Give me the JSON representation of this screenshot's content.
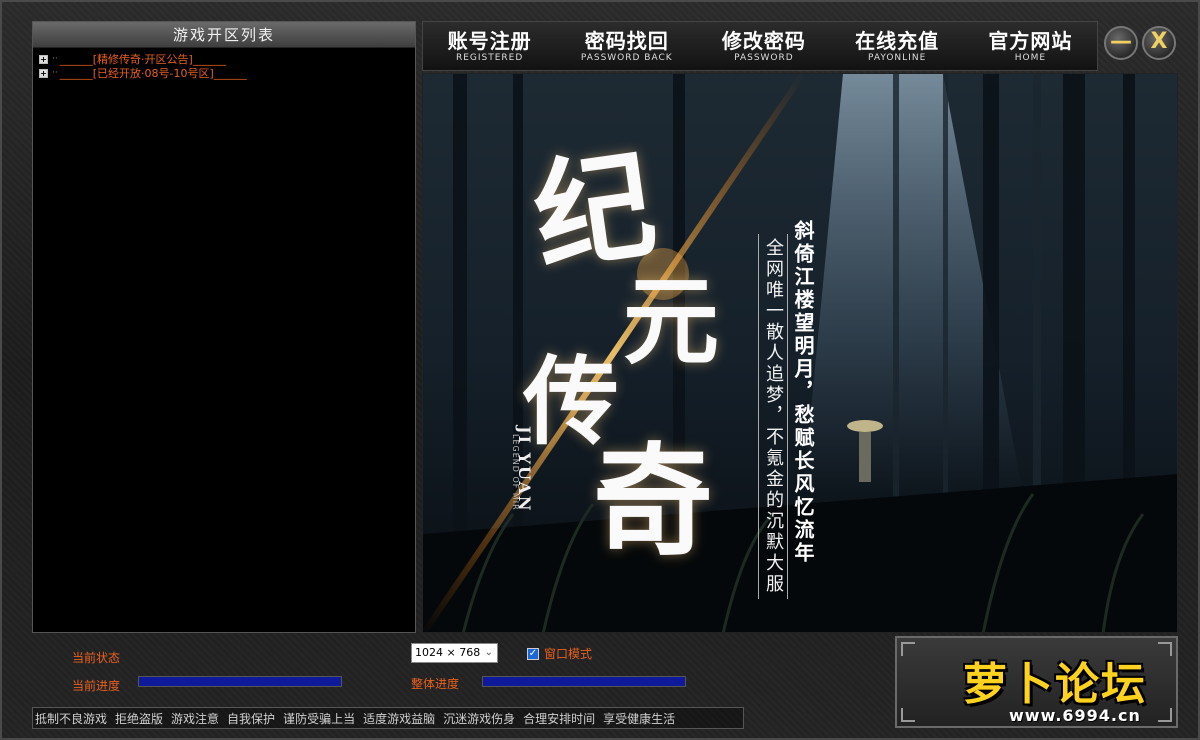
{
  "left_panel": {
    "title": "游戏开区列表",
    "servers": [
      {
        "label": "______[精修传奇·开区公告]______"
      },
      {
        "label": "______[已经开放·08号-10号区]______"
      }
    ]
  },
  "nav": {
    "items": [
      {
        "cn": "账号注册",
        "en": "REGISTERED"
      },
      {
        "cn": "密码找回",
        "en": "PASSWORD BACK"
      },
      {
        "cn": "修改密码",
        "en": "PASSWORD"
      },
      {
        "cn": "在线充值",
        "en": "PAYONLINE"
      },
      {
        "cn": "官方网站",
        "en": "HOME"
      }
    ],
    "minimize_glyph": "—",
    "close_glyph": "X"
  },
  "banner": {
    "title_chars": [
      "纪",
      "元",
      "传",
      "奇"
    ],
    "english_title": "JI YUAN",
    "english_sub": "LEGEND OF MIR",
    "slogan_left": "全网唯一散人追梦，不氪金的沉默大服",
    "slogan_right": "斜倚江楼望明月，愁赋长风忆流年"
  },
  "status": {
    "state_label": "当前状态",
    "current_progress_label": "当前进度",
    "total_progress_label": "整体进度",
    "current_progress": 1.0,
    "total_progress": 1.0,
    "resolution_value": "1024 × 768",
    "window_mode_label": "窗口模式",
    "window_mode_checked": true
  },
  "footer": {
    "items": [
      "抵制不良游戏",
      "拒绝盗版",
      "游戏注意",
      "自我保护",
      "谨防受骗上当",
      "适度游戏益脑",
      "沉迷游戏伤身",
      "合理安排时间",
      "享受健康生活"
    ]
  },
  "logo": {
    "text": "萝卜论坛",
    "url": "www.6994.cn"
  }
}
